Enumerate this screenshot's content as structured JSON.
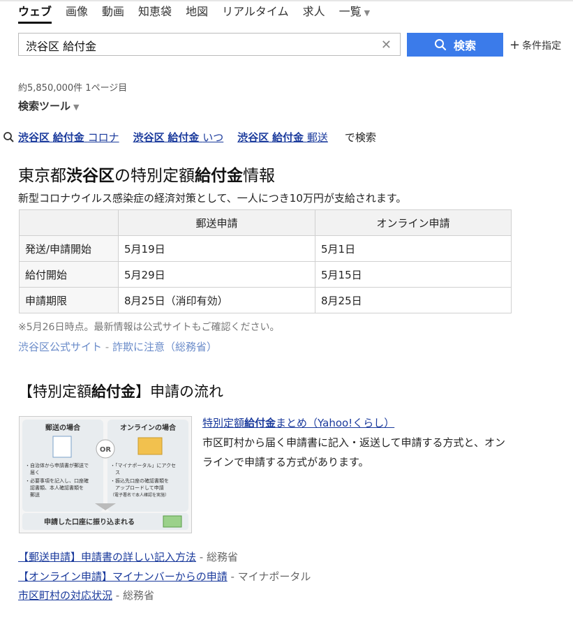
{
  "tabs": [
    {
      "label": "ウェブ"
    },
    {
      "label": "画像"
    },
    {
      "label": "動画"
    },
    {
      "label": "知恵袋"
    },
    {
      "label": "地図"
    },
    {
      "label": "リアルタイム"
    },
    {
      "label": "求人"
    },
    {
      "label": "一覧"
    }
  ],
  "search": {
    "query": "渋谷区 給付金",
    "button_label": "検索",
    "condition_label": "条件指定"
  },
  "results_count": "約5,850,000件 1ページ目",
  "search_tools": "検索ツール",
  "related": {
    "items": [
      {
        "b1": "渋谷区",
        "b2": "給付金",
        "rest": "コロナ"
      },
      {
        "b1": "渋谷区",
        "b2": "給付金",
        "rest": "いつ"
      },
      {
        "b1": "渋谷区",
        "b2": "給付金",
        "rest": "郵送"
      }
    ],
    "suffix": "で検索"
  },
  "info": {
    "title_parts": [
      "東京都",
      "渋谷区",
      "の特別定額",
      "給付金",
      "情報"
    ],
    "description": "新型コロナウイルス感染症の経済対策として、一人につき10万円が支給されます。",
    "table": {
      "headers": [
        "",
        "郵送申請",
        "オンライン申請"
      ],
      "rows": [
        [
          "発送/申請開始",
          "5月19日",
          "5月1日"
        ],
        [
          "給付開始",
          "5月29日",
          "5月15日"
        ],
        [
          "申請期限",
          "8月25日（消印有効）",
          "8月25日"
        ]
      ]
    },
    "note": "※5月26日時点。最新情報は公式サイトもご確認ください。",
    "link1": "渋谷区公式サイト",
    "sep": " - ",
    "link2": "詐欺に注意（総務省）"
  },
  "flow": {
    "title_parts": [
      "【特別定額",
      "給付金",
      "】申請の流れ"
    ],
    "thumb": {
      "left_title": "郵送の場合",
      "right_title": "オンラインの場合",
      "or": "OR",
      "left_text": [
        "・自治体から申請書が郵送で",
        "　届く",
        "・必要事項を記入し、口座確",
        "　認書類、本人確認書類を",
        "　郵送"
      ],
      "right_text": [
        "・「マイナポータル」にアクセ",
        "　ス",
        "・振込先口座の確認書類を",
        "　アップロードして申請"
      ],
      "right_small": "（電子署名で本人確認を実施）",
      "bottom": "申請した口座に振り込まれる"
    },
    "result_title_parts": [
      "特別定額",
      "給付金",
      "まとめ（Yahoo!くらし）"
    ],
    "result_desc": "市区町村から届く申請書に記入・返送して申請する方式と、オンラインで申請する方式があります。",
    "links": [
      {
        "text": "【郵送申請】申請書の詳しい記入方法",
        "source": "総務省"
      },
      {
        "text": "【オンライン申請】マイナンバーからの申請",
        "source": "マイナポータル"
      },
      {
        "text": "市区町村の対応状況",
        "source": "総務省"
      }
    ]
  },
  "colors": {
    "accent": "#3b7bea",
    "link": "#1a3a9c",
    "sublink": "#6a8bc9"
  }
}
